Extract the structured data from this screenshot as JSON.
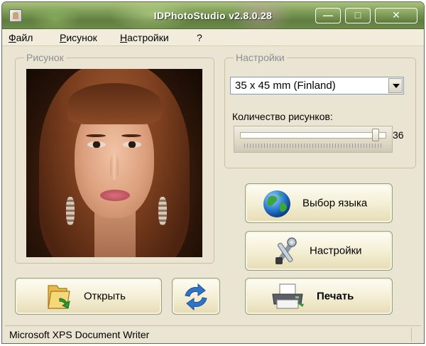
{
  "window": {
    "title": "IDPhotoStudio v2.8.0.28",
    "controls": {
      "minimize": "—",
      "maximize": "□",
      "close": "✕"
    }
  },
  "menu": {
    "items": [
      "Файл",
      "Рисунок",
      "Настройки",
      "?"
    ]
  },
  "picture_group": {
    "label": "Рисунок"
  },
  "settings_group": {
    "label": "Настройки",
    "format_select": {
      "value": "35 x 45 mm (Finland)"
    },
    "count_label": "Количество рисунков:",
    "count_value": "36",
    "count_slider_fraction": 0.95
  },
  "buttons": {
    "language": "Выбор языка",
    "settings": "Настройки",
    "open": "Открыть",
    "print": "Печать"
  },
  "icons": {
    "language": "globe-icon",
    "settings": "tools-icon",
    "open": "folder-open-icon",
    "refresh": "refresh-arrows-icon",
    "print": "printer-icon"
  },
  "status": {
    "printer": "Microsoft XPS Document Writer"
  }
}
